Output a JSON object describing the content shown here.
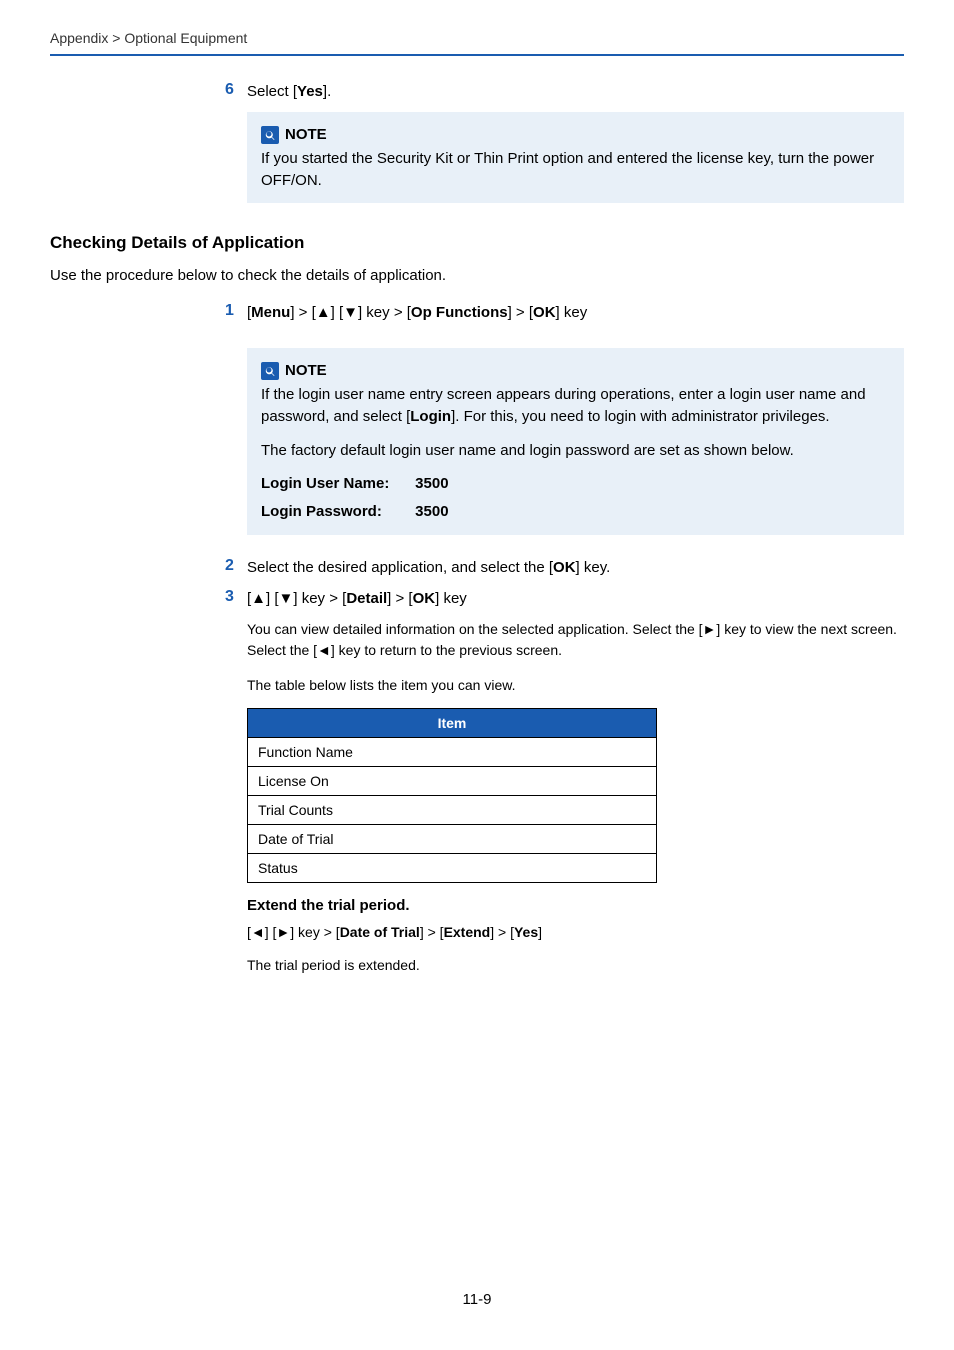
{
  "breadcrumb": "Appendix > Optional Equipment",
  "step6": {
    "num": "6",
    "prefix": "Select [",
    "bold": "Yes",
    "suffix": "]."
  },
  "note1": {
    "label": "NOTE",
    "text": "If you started the Security Kit or Thin Print option and entered the license key, turn the power OFF/ON."
  },
  "section_heading": "Checking Details of Application",
  "intro": "Use the procedure below to check the details of application.",
  "step1": {
    "num": "1",
    "parts": [
      "[",
      "Menu",
      "] > [▲] [▼] key > [",
      "Op Functions",
      "] > [",
      "OK",
      "] key"
    ]
  },
  "note2": {
    "label": "NOTE",
    "line1_a": "If the login user name entry screen appears during operations, enter a login user name and password, and select [",
    "line1_bold": "Login",
    "line1_b": "]. For this, you need to login with administrator privileges.",
    "line2": "The factory default login user name and login password are set as shown below.",
    "login_user_label": "Login User Name:",
    "login_user_value": "3500",
    "login_pass_label": "Login Password:",
    "login_pass_value": "3500"
  },
  "step2": {
    "num": "2",
    "a": "Select the desired application, and select the [",
    "b": "OK",
    "c": "] key."
  },
  "step3": {
    "num": "3",
    "a": "[▲] [▼] key > [",
    "b": "Detail",
    "c": "] > [",
    "d": "OK",
    "e": "] key",
    "sub1": "You can view detailed information on the selected application. Select the [►] key to view the next screen. Select the [◄] key to return to the previous screen.",
    "sub2": "The table below lists the item you can view."
  },
  "table": {
    "header": "Item",
    "rows": [
      "Function Name",
      "License On",
      "Trial Counts",
      "Date of Trial",
      "Status"
    ]
  },
  "extend": {
    "head": "Extend the trial period.",
    "a": "[◄] [►] key > [",
    "b": "Date of Trial",
    "c": "] > [",
    "d": "Extend",
    "e": "] > [",
    "f": "Yes",
    "g": "]",
    "after": "The trial period is extended."
  },
  "page_number": "11-9"
}
